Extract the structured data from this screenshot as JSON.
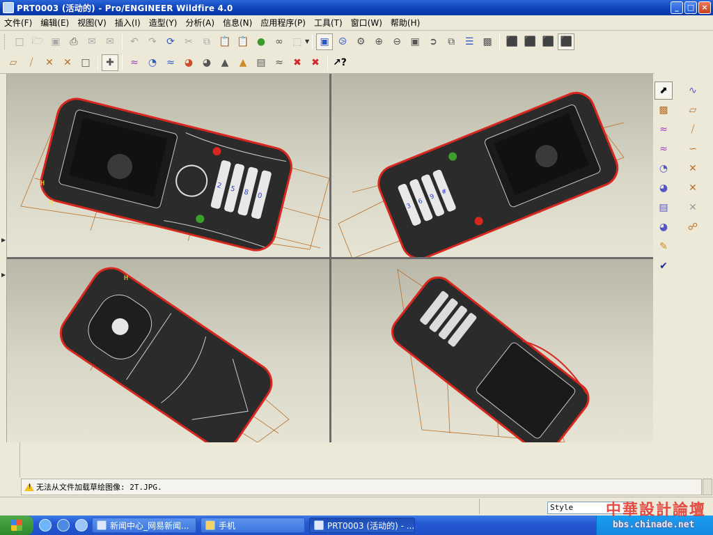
{
  "window": {
    "title": "PRT0003 (活动的) - Pro/ENGINEER Wildfire 4.0",
    "buttons": {
      "minimize": "_",
      "maximize": "□",
      "close": "×"
    }
  },
  "menu": [
    "文件(F)",
    "编辑(E)",
    "视图(V)",
    "插入(I)",
    "造型(Y)",
    "分析(A)",
    "信息(N)",
    "应用程序(P)",
    "工具(T)",
    "窗口(W)",
    "帮助(H)"
  ],
  "toolbar": {
    "row1": [
      "new-icon",
      "open-icon",
      "save-icon",
      "print-icon",
      "email-icon",
      "email-link-icon",
      "undo-icon",
      "redo-icon",
      "regenerate-icon",
      "cut-icon",
      "copy-icon",
      "paste-icon",
      "paste-special-icon",
      "model-player-icon",
      "find-icon",
      "select-box-icon",
      "repaint-icon",
      "spin-center-icon",
      "orient-mode-icon",
      "zoom-in-icon",
      "zoom-out-icon",
      "refit-icon",
      "reorient-icon",
      "saved-views-icon",
      "layers-icon",
      "view-manager-icon",
      "wireframe-icon",
      "hidden-line-icon",
      "no-hidden-icon",
      "shading-icon"
    ],
    "row2": [
      "datum-planes-icon",
      "datum-axes-icon",
      "datum-points-icon",
      "coord-sys-icon",
      "annotation-icon",
      "grid-icon",
      "curvature-icon",
      "section-icon",
      "offset-icon",
      "shade-analysis-icon",
      "reflection-icon",
      "draft-icon",
      "slope-icon",
      "dihedral-icon",
      "curve-analysis-icon",
      "delete-analysis-icon",
      "saved-analysis-icon",
      "context-help-icon"
    ]
  },
  "feature_toolbar": {
    "items": [
      "select-arrow-icon",
      "curve-style-icon",
      "sketch-plane-icon",
      "datum-plane-icon",
      "style-curve-icon",
      "datum-axis-icon",
      "curve-edit-icon",
      "curve-icon",
      "surface-edit-icon",
      "points-icon",
      "surface-icon",
      "offset-points-icon",
      "connect-icon",
      "trim-icon",
      "chain-icon",
      "surface-trim-icon",
      "done-check-icon"
    ]
  },
  "message": {
    "text": "无法从文件加载草绘图像: 2T.JPG.",
    "style_label": "Style"
  },
  "taskbar": {
    "items": [
      {
        "label": "新闻中心_网易新闻...",
        "active": false
      },
      {
        "label": "手机",
        "active": false
      },
      {
        "label": "PRT0003 (活动的) - ...",
        "active": true
      }
    ]
  },
  "watermark": {
    "line1": "中華設計論壇",
    "line2": "bbs.chinade.net"
  },
  "colors": {
    "phone_body": "#2b2b2b",
    "phone_trim": "#d8271e",
    "datum_planes": "#b8702a",
    "key_numbers": "#2a3fd6",
    "viewport_bg": "#c9c7b8"
  }
}
